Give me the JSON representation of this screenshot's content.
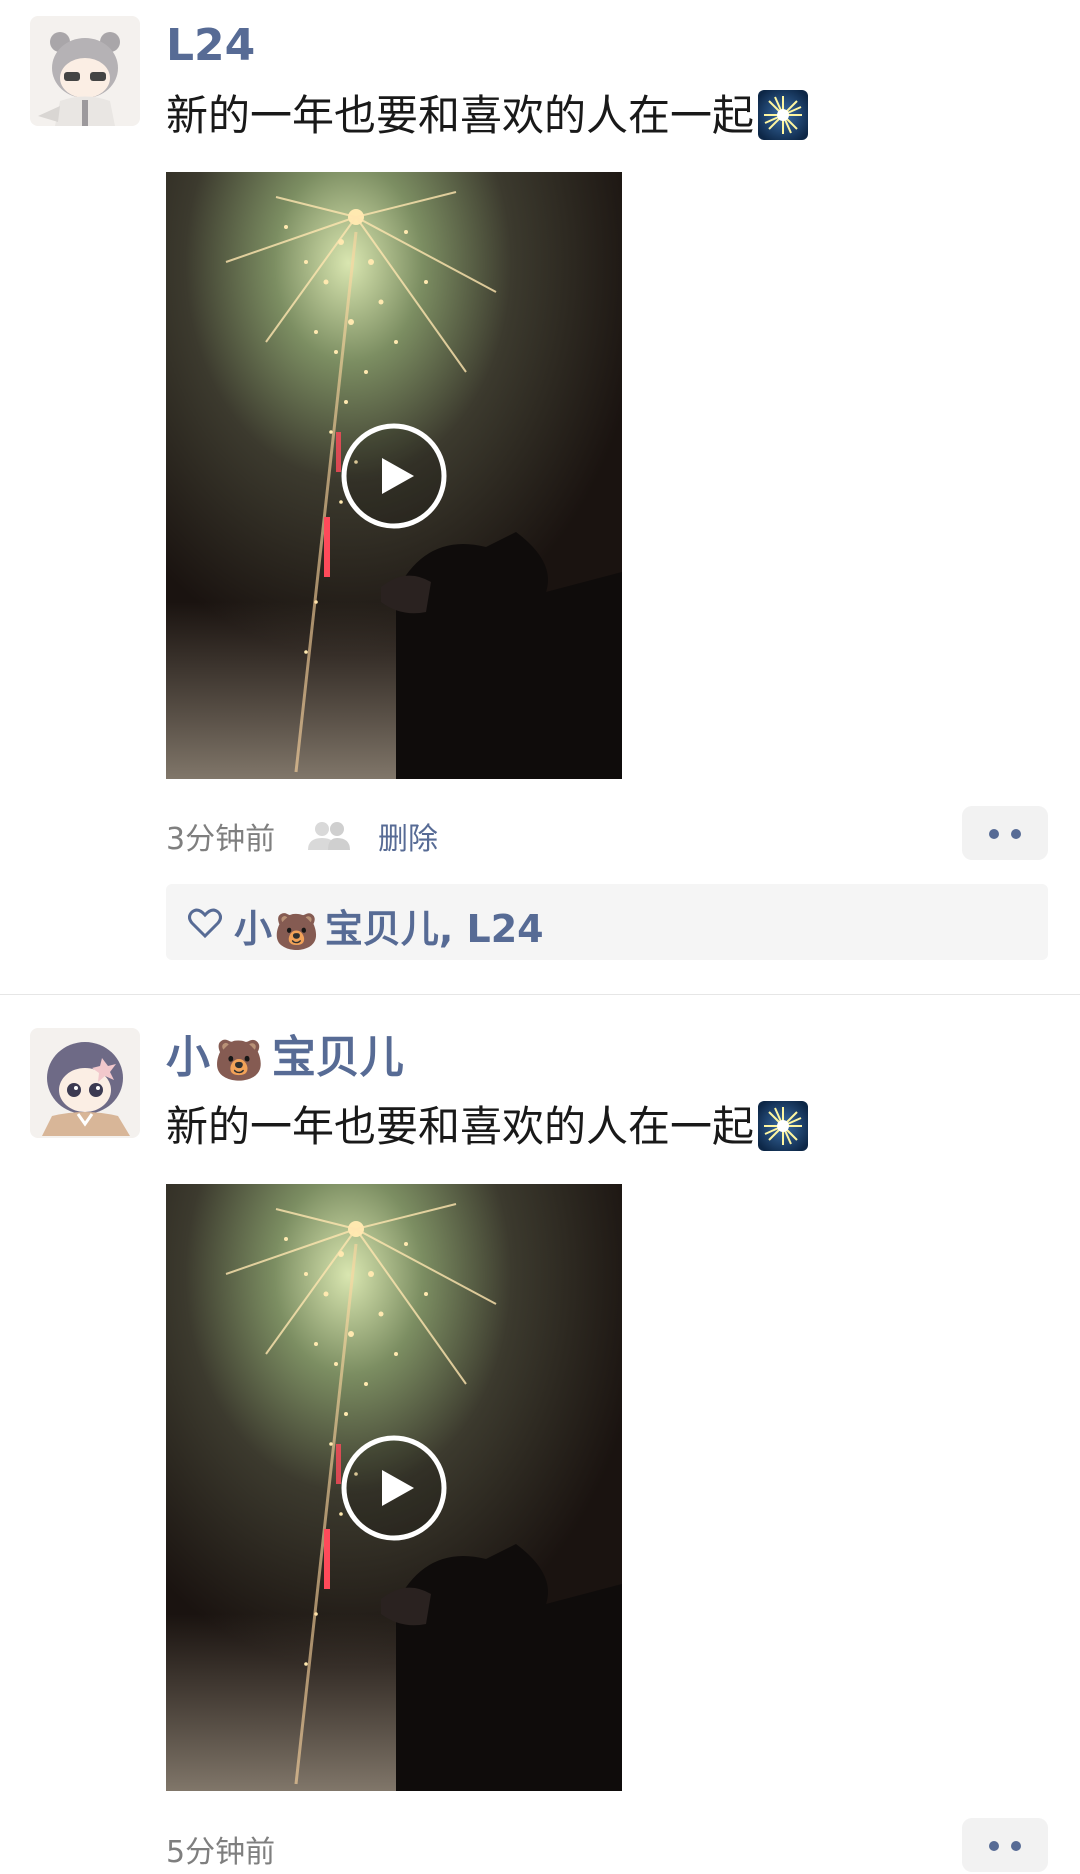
{
  "posts": [
    {
      "author": "L24",
      "text": "新的一年也要和喜欢的人在一起",
      "text_emoji": "sparkler-icon",
      "time": "3分钟前",
      "delete_label": "删除",
      "likes": {
        "name1_prefix": "小",
        "name1_suffix": "宝贝儿",
        "separator": ", ",
        "name2": "L24"
      }
    },
    {
      "author_prefix": "小",
      "author_suffix": "宝贝儿",
      "text": "新的一年也要和喜欢的人在一起",
      "text_emoji": "sparkler-icon",
      "time": "5分钟前"
    }
  ],
  "colors": {
    "link": "#576b95",
    "text": "#191919",
    "meta": "#7f7f7f",
    "likes_bg": "#f5f5f5"
  }
}
